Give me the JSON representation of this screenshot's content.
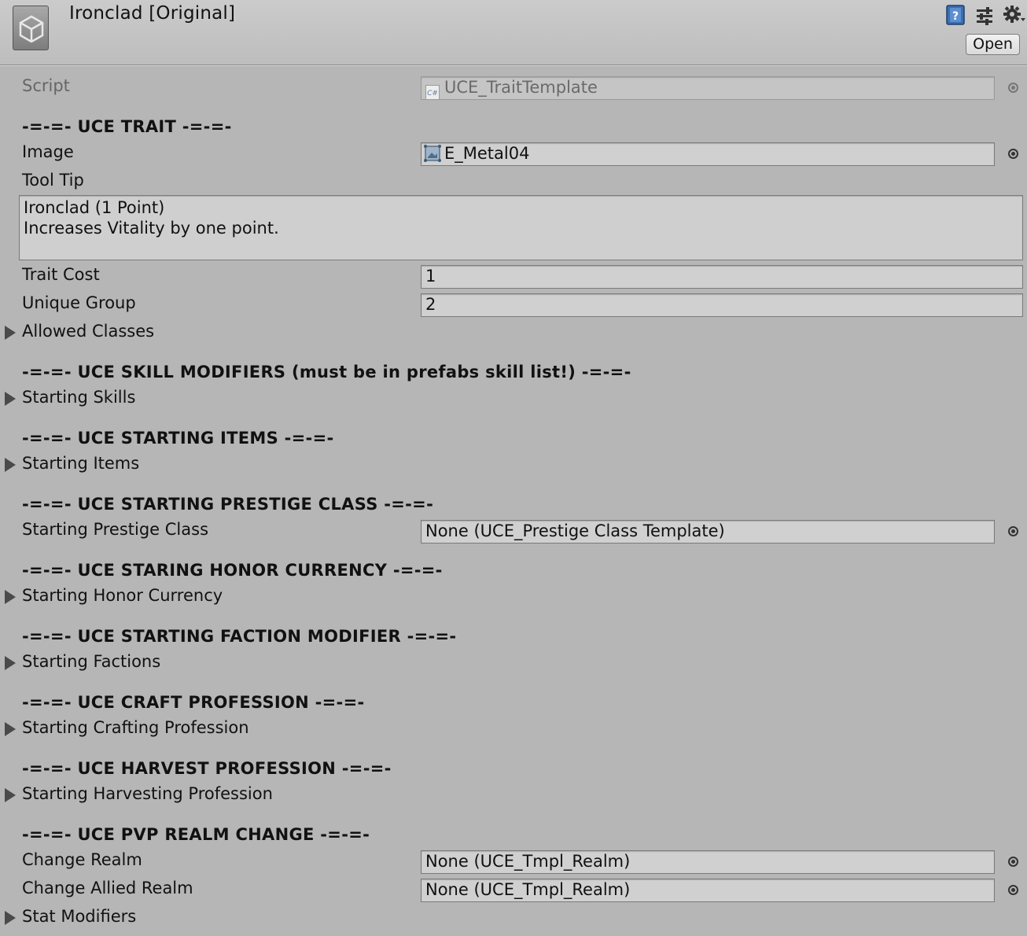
{
  "header": {
    "title": "Ironclad [Original]",
    "open_label": "Open",
    "icons": [
      "unity-logo-icon",
      "help-book-icon",
      "preset-sliders-icon",
      "gear-icon"
    ]
  },
  "script_row": {
    "label": "Script",
    "value": "UCE_TraitTemplate",
    "icon": "csharp-script-icon"
  },
  "sections": {
    "trait": "-=-=- UCE TRAIT -=-=-",
    "skills": "-=-=- UCE SKILL MODIFIERS (must be in prefabs skill list!) -=-=-",
    "items": "-=-=- UCE STARTING ITEMS -=-=-",
    "prestige": "-=-=- UCE STARTING PRESTIGE CLASS -=-=-",
    "honor": "-=-=- UCE STARING HONOR CURRENCY -=-=-",
    "faction": "-=-=- UCE STARTING FACTION MODIFIER -=-=-",
    "craft": "-=-=- UCE CRAFT PROFESSION -=-=-",
    "harvest": "-=-=- UCE HARVEST PROFESSION -=-=-",
    "pvp": "-=-=- UCE PVP REALM CHANGE -=-=-"
  },
  "fields": {
    "image": {
      "label": "Image",
      "value": "E_Metal04",
      "icon": "sprite-icon"
    },
    "tooltip": {
      "label": "Tool Tip",
      "lines": [
        "Ironclad (1 Point)",
        "Increases Vitality by one point."
      ]
    },
    "trait_cost": {
      "label": "Trait Cost",
      "value": "1"
    },
    "unique_group": {
      "label": "Unique Group",
      "value": "2"
    },
    "allowed_classes": {
      "label": "Allowed Classes"
    },
    "starting_skills": {
      "label": "Starting Skills"
    },
    "starting_items": {
      "label": "Starting Items"
    },
    "starting_prestige_class": {
      "label": "Starting Prestige Class",
      "value": "None (UCE_Prestige Class Template)"
    },
    "starting_honor_currency": {
      "label": "Starting Honor Currency"
    },
    "starting_factions": {
      "label": "Starting Factions"
    },
    "starting_crafting_profession": {
      "label": "Starting Crafting Profession"
    },
    "starting_harvesting_profession": {
      "label": "Starting Harvesting Profession"
    },
    "change_realm": {
      "label": "Change Realm",
      "value": "None (UCE_Tmpl_Realm)"
    },
    "change_allied_realm": {
      "label": "Change Allied Realm",
      "value": "None (UCE_Tmpl_Realm)"
    },
    "stat_modifiers": {
      "label": "Stat Modifiers"
    }
  }
}
